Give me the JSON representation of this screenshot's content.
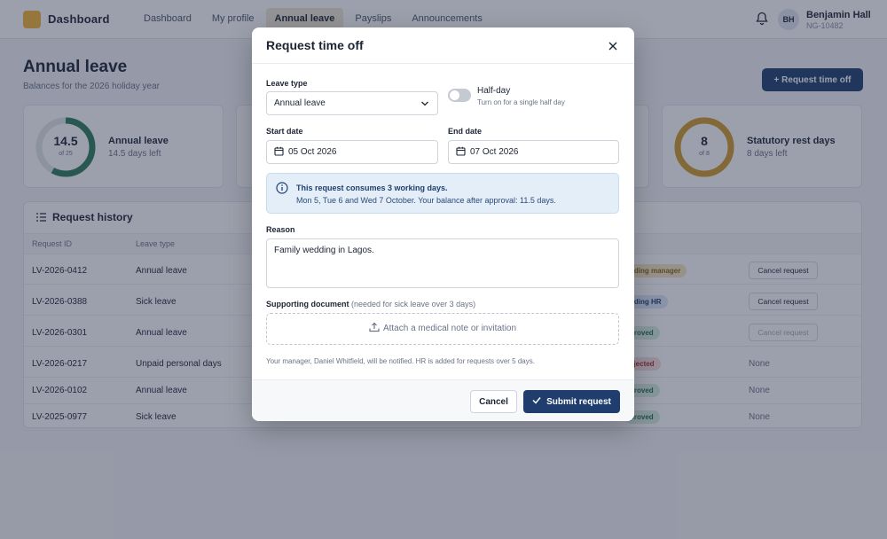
{
  "nav": {
    "brand": "Dashboard",
    "items": [
      "Dashboard",
      "My profile",
      "Annual leave",
      "Payslips",
      "Announcements"
    ],
    "active_index": 2
  },
  "user": {
    "initials": "BH",
    "name": "Benjamin Hall",
    "id": "NG-10482"
  },
  "page": {
    "title": "Annual leave",
    "subtitle": "Balances for the 2026 holiday year",
    "request_button": "+ Request time off"
  },
  "cards": [
    {
      "value": "14.5",
      "of": "of 25",
      "title": "Annual leave",
      "sub": "14.5 days left",
      "color": "#2f7d5b",
      "fraction": 0.58
    },
    {
      "value": "8",
      "of": "of 8",
      "title": "Statutory rest days",
      "sub": "8 days left",
      "color": "#d29b2c",
      "fraction": 1.0
    }
  ],
  "history": {
    "title": "Request history",
    "columns": [
      "Request ID",
      "Leave type"
    ],
    "rows": [
      {
        "id": "LV-2026-0412",
        "type": "Annual leave",
        "status": "nding manager",
        "status_kind": "pending",
        "action": "Cancel request",
        "action_state": "enabled"
      },
      {
        "id": "LV-2026-0388",
        "type": "Sick leave",
        "status": "nding HR",
        "status_kind": "hr",
        "action": "Cancel request",
        "action_state": "enabled"
      },
      {
        "id": "LV-2026-0301",
        "type": "Annual leave",
        "status": "proved",
        "status_kind": "approved",
        "action": "Cancel request",
        "action_state": "disabled"
      },
      {
        "id": "LV-2026-0217",
        "type": "Unpaid personal days",
        "status": "ejected",
        "status_kind": "rejected",
        "action": "None",
        "action_state": "none"
      },
      {
        "id": "LV-2026-0102",
        "type": "Annual leave",
        "status": "proved",
        "status_kind": "approved",
        "action": "None",
        "action_state": "none"
      },
      {
        "id": "LV-2025-0977",
        "type": "Sick leave",
        "status": "proved",
        "status_kind": "approved",
        "action": "None",
        "action_state": "none"
      }
    ]
  },
  "modal": {
    "title": "Request time off",
    "leave_type_label": "Leave type",
    "leave_type_value": "Annual leave",
    "halfday_title": "Half-day",
    "halfday_sub": "Turn on for a single half day",
    "halfday_on": false,
    "start_label": "Start date",
    "start_value": "05 Oct 2026",
    "end_label": "End date",
    "end_value": "07 Oct 2026",
    "info_title": "This request consumes 3 working days.",
    "info_text": "Mon 5, Tue 6 and Wed 7 October. Your balance after approval: 11.5 days.",
    "reason_label": "Reason",
    "reason_value": "Family wedding in Lagos.",
    "doc_label": "Supporting document",
    "doc_hint": "(needed for sick leave over 3 days)",
    "upload_text": "Attach a medical note or invitation",
    "notify_text": "Your manager, Daniel Whitfield, will be notified. HR is added for requests over 5 days.",
    "cancel_label": "Cancel",
    "submit_label": "Submit request"
  },
  "colors": {
    "primary": "#1f3e6e",
    "info_bg": "#e4eef9",
    "badge_pending": "#f4e6bf",
    "badge_hr": "#dbe6f7",
    "badge_approved": "#d8efe2",
    "badge_rejected": "#f7dcdc"
  },
  "icons": [
    "bell-icon",
    "list-icon",
    "close-icon",
    "chevron-down-icon",
    "calendar-icon",
    "info-icon",
    "upload-icon",
    "check-icon",
    "plus-icon"
  ]
}
